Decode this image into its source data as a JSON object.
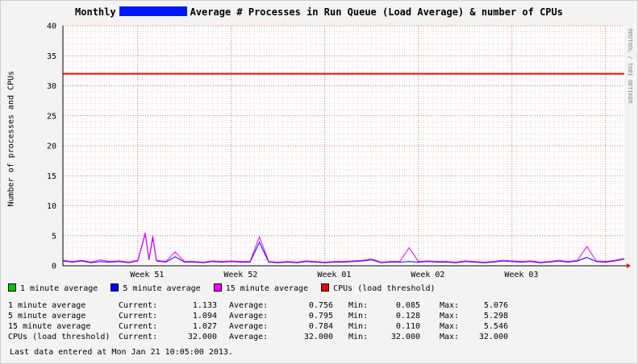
{
  "title": {
    "prefix": "Monthly",
    "suffix": "Average # Processes in Run Queue (Load Average) & number of CPUs"
  },
  "side_text": "RRDTOOL / TOBI OETIKER",
  "chart_data": {
    "type": "line",
    "ylabel": "Number of processes and CPUs",
    "ylim": [
      0,
      40
    ],
    "yticks": [
      0,
      5,
      10,
      15,
      20,
      25,
      30,
      35,
      40
    ],
    "ytick_labels": [
      "0",
      "5",
      "10",
      "15",
      "20",
      "25",
      "30",
      "35",
      "40"
    ],
    "xlim": [
      0,
      30
    ],
    "xticks": [
      {
        "label": "Week 51",
        "x": 4.5
      },
      {
        "label": "Week 52",
        "x": 9.5
      },
      {
        "label": "Week 01",
        "x": 14.5
      },
      {
        "label": "Week 02",
        "x": 19.5
      },
      {
        "label": "Week 03",
        "x": 24.5
      }
    ],
    "day_lines": [
      4,
      9,
      14,
      19,
      24,
      29
    ],
    "grid": true,
    "series": [
      {
        "name": "1 minute average",
        "color": "#00cc00"
      },
      {
        "name": "5 minute average",
        "color": "#0000ff",
        "x": [
          0,
          0.5,
          1,
          1.5,
          2,
          2.5,
          3,
          3.5,
          4,
          4.4,
          4.6,
          4.8,
          5,
          5.5,
          6,
          6.5,
          7,
          7.5,
          8,
          8.5,
          9,
          9.5,
          10,
          10.5,
          11,
          11.5,
          12,
          12.5,
          13,
          13.5,
          14,
          14.5,
          15,
          15.5,
          16,
          16.5,
          17,
          17.5,
          18,
          18.5,
          19,
          19.5,
          20,
          20.5,
          21,
          21.5,
          22,
          22.5,
          23,
          23.5,
          24,
          24.5,
          25,
          25.5,
          26,
          26.5,
          27,
          27.5,
          28,
          28.5,
          29,
          29.5,
          30
        ],
        "y": [
          0.8,
          0.6,
          0.8,
          0.5,
          0.7,
          0.6,
          0.7,
          0.5,
          0.8,
          5.3,
          1.0,
          4.7,
          0.8,
          0.6,
          1.5,
          0.6,
          0.6,
          0.5,
          0.7,
          0.6,
          0.7,
          0.6,
          0.6,
          3.9,
          0.6,
          0.5,
          0.6,
          0.5,
          0.7,
          0.6,
          0.5,
          0.6,
          0.6,
          0.7,
          0.8,
          1.0,
          0.5,
          0.6,
          0.6,
          0.7,
          0.6,
          0.7,
          0.6,
          0.6,
          0.5,
          0.7,
          0.6,
          0.5,
          0.6,
          0.8,
          0.7,
          0.6,
          0.7,
          0.5,
          0.6,
          0.8,
          0.6,
          0.8,
          1.4,
          0.7,
          0.6,
          0.8,
          1.1
        ]
      },
      {
        "name": "15 minute average",
        "color": "#ff00ff",
        "x": [
          0,
          0.5,
          1,
          1.5,
          2,
          2.5,
          3,
          3.5,
          4,
          4.4,
          4.6,
          4.8,
          5,
          5.5,
          6,
          6.5,
          7,
          7.5,
          8,
          8.5,
          9,
          9.5,
          10,
          10.5,
          11,
          11.5,
          12,
          12.5,
          13,
          13.5,
          14,
          14.5,
          15,
          15.5,
          16,
          16.5,
          17,
          17.5,
          18,
          18.5,
          19,
          19.5,
          20,
          20.5,
          21,
          21.5,
          22,
          22.5,
          23,
          23.5,
          24,
          24.5,
          25,
          25.5,
          26,
          26.5,
          27,
          27.5,
          28,
          28.5,
          29,
          29.5,
          30
        ],
        "y": [
          0.9,
          0.7,
          0.9,
          0.6,
          1.0,
          0.7,
          0.8,
          0.6,
          0.9,
          5.5,
          1.2,
          5.0,
          0.9,
          0.7,
          2.3,
          0.7,
          0.7,
          0.6,
          0.8,
          0.7,
          0.8,
          0.7,
          0.7,
          4.8,
          0.7,
          0.6,
          0.7,
          0.6,
          0.8,
          0.7,
          0.6,
          0.7,
          0.7,
          0.8,
          0.9,
          1.1,
          0.6,
          0.7,
          0.7,
          3.0,
          0.7,
          0.8,
          0.7,
          0.7,
          0.6,
          0.8,
          0.7,
          0.6,
          0.7,
          0.9,
          0.8,
          0.7,
          0.8,
          0.6,
          0.7,
          0.9,
          0.7,
          0.9,
          3.2,
          0.8,
          0.7,
          0.9,
          1.2
        ]
      },
      {
        "name": "CPUs (load threshold)",
        "color": "#ff0000",
        "x": [
          0,
          30
        ],
        "y": [
          32,
          32
        ]
      }
    ]
  },
  "stats": {
    "headers": [
      "Current:",
      "Average:",
      "Min:",
      "Max:"
    ],
    "rows": [
      {
        "name": "1 minute average",
        "current": "1.133",
        "average": "0.756",
        "min": "0.085",
        "max": "5.076"
      },
      {
        "name": "5 minute average",
        "current": "1.094",
        "average": "0.795",
        "min": "0.128",
        "max": "5.298"
      },
      {
        "name": "15 minute average",
        "current": "1.027",
        "average": "0.784",
        "min": "0.110",
        "max": "5.546"
      },
      {
        "name": "CPUs (load threshold)",
        "current": "32.000",
        "average": "32.000",
        "min": "32.000",
        "max": "32.000"
      }
    ]
  },
  "footer": "Last data entered at Mon Jan 21 10:05:00 2013."
}
